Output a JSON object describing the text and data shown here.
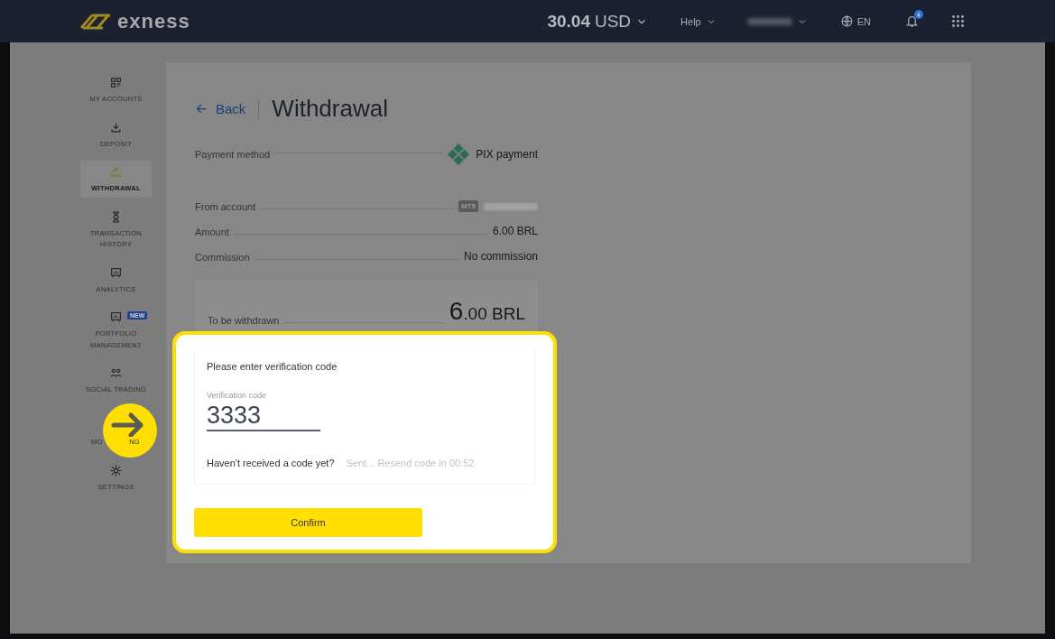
{
  "header": {
    "logo": "exness",
    "balance": "30.04",
    "currency": "USD",
    "help": "Help",
    "language": "EN",
    "notification_count": "4"
  },
  "sidebar": {
    "items": [
      {
        "kind": "item",
        "label": "MY ACCOUNTS",
        "selected": false
      },
      {
        "kind": "item",
        "label": "DEPOSIT",
        "selected": false
      },
      {
        "kind": "item",
        "label": "WITHDRAWAL",
        "selected": true
      },
      {
        "kind": "item",
        "label": "TRANSACTION HISTORY",
        "selected": false
      },
      {
        "kind": "item",
        "label": "ANALYTICS",
        "selected": false
      },
      {
        "kind": "item",
        "label": "PORTFOLIO MANAGEMENT",
        "badge": "NEW",
        "selected": false
      },
      {
        "kind": "item",
        "label": "SOCIAL TRADING",
        "selected": false
      },
      {
        "kind": "covered",
        "label_start": "MO",
        "label_end": "NG",
        "selected": false
      },
      {
        "kind": "item",
        "label": "SETTINGS",
        "selected": false
      }
    ]
  },
  "page": {
    "back": "Back",
    "title": "Withdrawal",
    "details": [
      {
        "kind": "method",
        "label": "Payment method",
        "value": "PIX payment"
      },
      {
        "kind": "account",
        "label": "From account",
        "tag": "MT5"
      },
      {
        "kind": "plain",
        "label": "Amount",
        "value": "6.00 BRL"
      },
      {
        "kind": "plain",
        "label": "Commission",
        "value": "No commission"
      }
    ],
    "total": {
      "label": "To be withdrawn",
      "whole": "6",
      "rest": ".00 BRL"
    }
  },
  "dialog": {
    "prompt": "Please enter verification code",
    "field_label": "Verification code",
    "value": "3333",
    "question": "Haven't received a code yet?",
    "resend": "Sent... Resend code in 00:52",
    "button": "Confirm"
  }
}
